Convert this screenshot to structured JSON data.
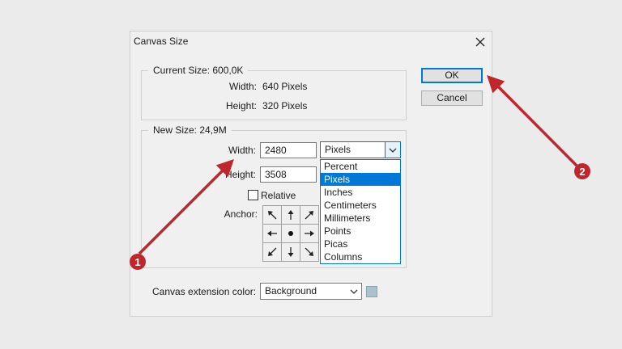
{
  "window": {
    "title": "Canvas Size"
  },
  "current_size": {
    "legend": "Current Size: 600,0K",
    "width_label": "Width:",
    "width_value": "640 Pixels",
    "height_label": "Height:",
    "height_value": "320 Pixels"
  },
  "new_size": {
    "legend": "New Size: 24,9M",
    "width_label": "Width:",
    "width_value": "2480",
    "height_label": "Height:",
    "height_value": "3508",
    "unit_selected": "Pixels",
    "unit_options": [
      "Percent",
      "Pixels",
      "Inches",
      "Centimeters",
      "Millimeters",
      "Points",
      "Picas",
      "Columns"
    ],
    "relative_label": "Relative",
    "relative_checked": false,
    "anchor_label": "Anchor:"
  },
  "canvas_extension": {
    "label": "Canvas extension color:",
    "value": "Background",
    "swatch_color": "#a9c2ce"
  },
  "buttons": {
    "ok": "OK",
    "cancel": "Cancel"
  },
  "callouts": [
    "1",
    "2"
  ],
  "colors": {
    "accent": "#0078d7",
    "annotation": "#c0272d"
  }
}
